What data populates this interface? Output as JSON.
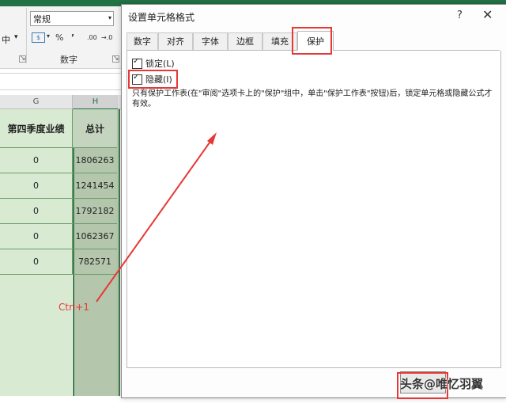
{
  "ribbon": {
    "left_text": "中",
    "number_format": "常规",
    "percent_symbol": "%",
    "comma_symbol": "’",
    "decimal_icons": [
      ".00",
      "→.0"
    ],
    "group_label": "数字"
  },
  "sheet": {
    "col_headers": [
      "G",
      "H"
    ],
    "header_cells": [
      "第四季度业绩",
      "总计"
    ],
    "rows": [
      {
        "g": "0",
        "h": "1806263"
      },
      {
        "g": "0",
        "h": "1241454"
      },
      {
        "g": "0",
        "h": "1792182"
      },
      {
        "g": "0",
        "h": "1062367"
      },
      {
        "g": "0",
        "h": "782571"
      }
    ]
  },
  "annotation": {
    "shortcut": "Ctrl+1"
  },
  "dialog": {
    "title": "设置单元格格式",
    "help": "?",
    "close": "✕",
    "tabs": [
      "数字",
      "对齐",
      "字体",
      "边框",
      "填充",
      "保护"
    ],
    "active_tab": "保护",
    "locked": {
      "label": "锁定(L)",
      "checked": true
    },
    "hidden": {
      "label": "隐藏(I)",
      "checked": true
    },
    "description": "只有保护工作表(在\"审阅\"选项卡上的\"保护\"组中，单击\"保护工作表\"按钮)后，锁定单元格或隐藏公式才有效。"
  },
  "watermark": "头条@唯忆羽翼",
  "colors": {
    "excel_green": "#217346",
    "highlight_red": "#e53935",
    "cell_green": "#d9ead3"
  }
}
